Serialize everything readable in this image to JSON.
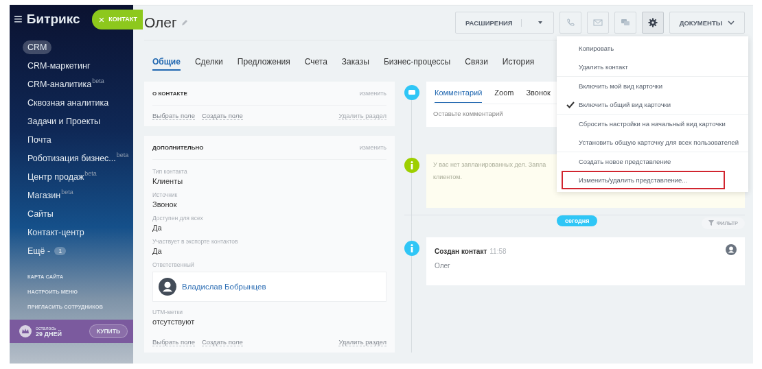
{
  "sidebar": {
    "logo": "Битрикс",
    "menu_icon": "≡",
    "add_button": {
      "icon": "×",
      "label": "КОНТАКТ"
    },
    "items": [
      {
        "label": "CRM",
        "selected": true
      },
      {
        "label": "CRM-маркетинг",
        "selected": false
      },
      {
        "label": "CRM-аналитика",
        "sup": "beta",
        "selected": false
      },
      {
        "label": "Сквозная аналитика",
        "selected": false
      },
      {
        "label": "Задачи и Проекты",
        "selected": false
      },
      {
        "label": "Почта",
        "selected": false
      },
      {
        "label": "Роботизация бизнес...",
        "sup": "beta",
        "selected": false
      },
      {
        "label": "Центр продаж",
        "sup": "beta",
        "selected": false
      },
      {
        "label": "Магазин",
        "sup": "beta",
        "selected": false
      },
      {
        "label": "Сайты",
        "selected": false
      },
      {
        "label": "Контакт-центр",
        "selected": false
      },
      {
        "label": "Ещё -",
        "counter": "1",
        "selected": false
      }
    ],
    "links": [
      "КАРТА САЙТА",
      "НАСТРОИТЬ МЕНЮ",
      "ПРИГЛАСИТЬ СОТРУДНИКОВ"
    ],
    "trial": {
      "caption": "осталось",
      "days": "29 ДНЕЙ",
      "button": "КУПИТЬ"
    }
  },
  "header": {
    "title": "Олег",
    "extensions_button": "РАСШИРЕНИЯ",
    "documents_button": "ДОКУМЕНТЫ"
  },
  "tabs": [
    {
      "label": "Общие",
      "selected": true
    },
    {
      "label": "Сделки",
      "selected": false
    },
    {
      "label": "Предложения",
      "selected": false
    },
    {
      "label": "Счета",
      "selected": false
    },
    {
      "label": "Заказы",
      "selected": false
    },
    {
      "label": "Бизнес-процессы",
      "selected": false
    },
    {
      "label": "Связи",
      "selected": false
    },
    {
      "label": "История",
      "selected": false
    }
  ],
  "sections": [
    {
      "title": "О КОНТАКТЕ",
      "edit": "изменить",
      "actions": [
        "Выбрать поле",
        "Создать поле"
      ],
      "delete": {
        "label": "Удалить раздел",
        "disabled": true
      }
    },
    {
      "title": "ДОПОЛНИТЕЛЬНО",
      "edit": "изменить",
      "fields": [
        {
          "kind": "text",
          "label": "Тип контакта",
          "value": "Клиенты"
        },
        {
          "kind": "text",
          "label": "Источник",
          "value": "Звонок"
        },
        {
          "kind": "text",
          "label": "Доступен для всех",
          "value": "Да"
        },
        {
          "kind": "text",
          "label": "Участвует в экспорте контактов",
          "value": "Да"
        },
        {
          "kind": "user",
          "label": "Ответственный",
          "value": "Владислав Бобрынцев"
        },
        {
          "kind": "text",
          "label": "UTM-метки",
          "value": "отсутствуют"
        }
      ],
      "actions": [
        "Выбрать поле",
        "Создать поле"
      ],
      "delete": {
        "label": "Удалить раздел",
        "disabled": false
      }
    }
  ],
  "timeline": {
    "editor_tabs": [
      {
        "label": "Комментарий",
        "selected": true
      },
      {
        "label": "Zoom",
        "selected": false
      },
      {
        "label": "Звонок",
        "selected": false
      }
    ],
    "comment_placeholder": "Оставьте комментарий",
    "notice_lines": [
      "У вас нет запланированных дел. Запла",
      "клиентом."
    ],
    "today": "сегодня",
    "filter": "ФИЛЬТР",
    "events": [
      {
        "title": "Создан контакт",
        "time": "11:58",
        "text": "Олег"
      }
    ]
  },
  "menu": {
    "groups": [
      [
        {
          "label": "Копировать",
          "checked": false,
          "highlighted": false
        },
        {
          "label": "Удалить контакт",
          "checked": false,
          "highlighted": false
        }
      ],
      [
        {
          "label": "Включить мой вид карточки",
          "checked": false,
          "highlighted": false
        },
        {
          "label": "Включить общий вид карточки",
          "checked": true,
          "highlighted": false
        }
      ],
      [
        {
          "label": "Сбросить настройки на начальный вид карточки",
          "checked": false,
          "highlighted": false
        },
        {
          "label": "Установить общую карточку для всех пользователей",
          "checked": false,
          "highlighted": false
        }
      ],
      [
        {
          "label": "Создать новое представление",
          "checked": false,
          "highlighted": false
        },
        {
          "label": "Изменить/удалить представление...",
          "checked": false,
          "highlighted": true
        }
      ]
    ]
  }
}
